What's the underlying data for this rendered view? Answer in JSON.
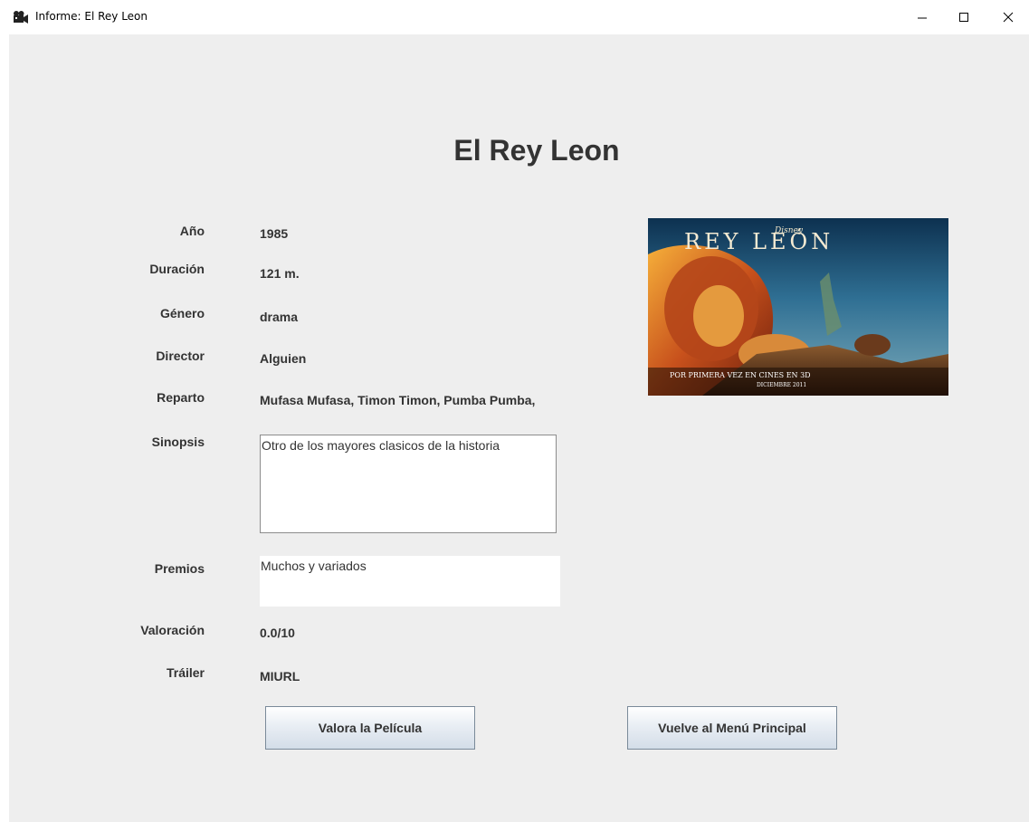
{
  "window": {
    "title": "Informe: El Rey Leon",
    "app_icon": "film-camera-icon"
  },
  "movie": {
    "title": "El Rey Leon",
    "poster": {
      "title_text": "REY LEÓN",
      "brand_text": "Disney",
      "tagline": "POR PRIMERA VEZ EN CINES EN 3D",
      "date_text": "DICIEMBRE 2011"
    }
  },
  "fields": {
    "anio": {
      "label": "Año",
      "value": "1985"
    },
    "duracion": {
      "label": "Duración",
      "value": "121 m."
    },
    "genero": {
      "label": "Género",
      "value": "drama"
    },
    "director": {
      "label": "Director",
      "value": "Alguien"
    },
    "reparto": {
      "label": "Reparto",
      "value": "Mufasa Mufasa, Timon Timon, Pumba Pumba,"
    },
    "sinopsis": {
      "label": "Sinopsis",
      "value": "Otro de los mayores clasicos de la historia"
    },
    "premios": {
      "label": "Premios",
      "value": "Muchos y variados"
    },
    "valoracion": {
      "label": "Valoración",
      "value": "0.0/10"
    },
    "trailer": {
      "label": "Tráiler",
      "value": "MIURL"
    }
  },
  "buttons": {
    "rate": "Valora la Película",
    "back": "Vuelve al Menú Principal"
  }
}
